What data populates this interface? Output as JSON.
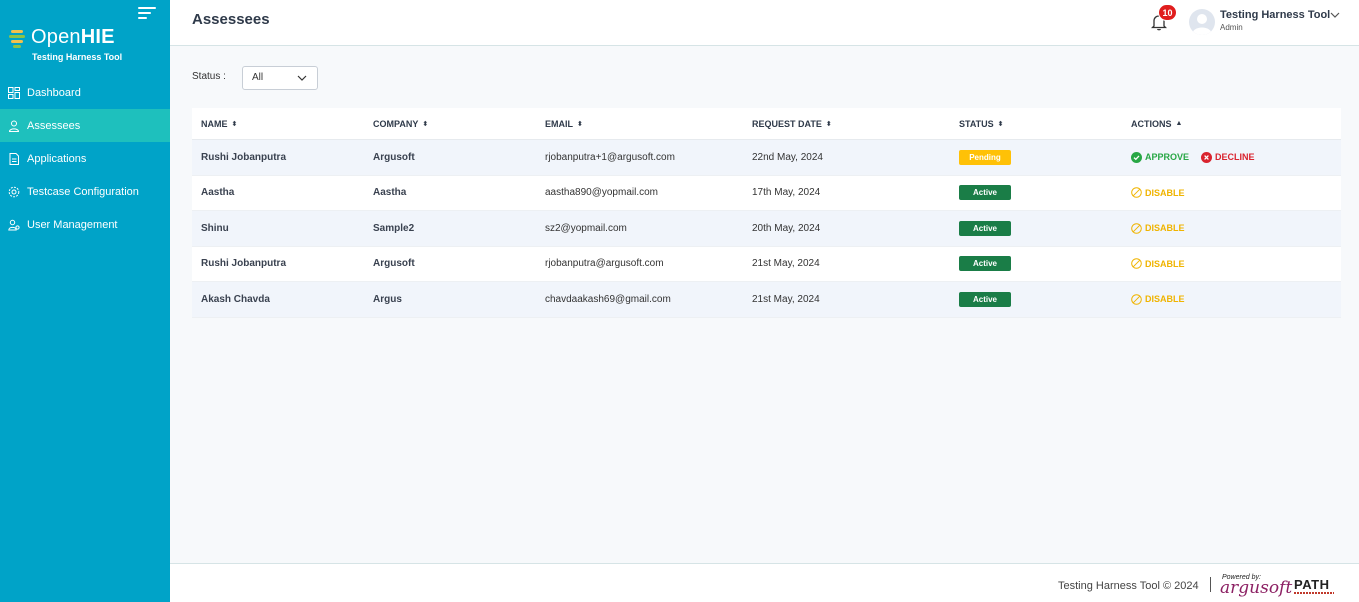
{
  "app": {
    "logo_prefix": "Open",
    "logo_bold": "HIE",
    "logo_subtitle": "Testing Harness Tool"
  },
  "sidebar": {
    "items": [
      {
        "label": "Dashboard",
        "icon": "dashboard-icon"
      },
      {
        "label": "Assessees",
        "icon": "user-icon",
        "active": true
      },
      {
        "label": "Applications",
        "icon": "document-icon"
      },
      {
        "label": "Testcase Configuration",
        "icon": "gear-icon"
      },
      {
        "label": "User Management",
        "icon": "users-icon"
      }
    ]
  },
  "header": {
    "title": "Assessees",
    "notification_count": "10",
    "user_name": "Testing Harness Tool",
    "user_role": "Admin"
  },
  "filter": {
    "label": "Status :",
    "selected": "All"
  },
  "table": {
    "columns": [
      "NAME",
      "COMPANY",
      "EMAIL",
      "REQUEST DATE",
      "STATUS",
      "ACTIONS"
    ],
    "rows": [
      {
        "name": "Rushi Jobanputra",
        "company": "Argusoft",
        "email": "rjobanputra+1@argusoft.com",
        "date": "22nd May, 2024",
        "status": "Pending",
        "actions": [
          "APPROVE",
          "DECLINE"
        ]
      },
      {
        "name": "Aastha",
        "company": "Aastha",
        "email": "aastha890@yopmail.com",
        "date": "17th May, 2024",
        "status": "Active",
        "actions": [
          "DISABLE"
        ]
      },
      {
        "name": "Shinu",
        "company": "Sample2",
        "email": "sz2@yopmail.com",
        "date": "20th May, 2024",
        "status": "Active",
        "actions": [
          "DISABLE"
        ]
      },
      {
        "name": "Rushi Jobanputra",
        "company": "Argusoft",
        "email": "rjobanputra@argusoft.com",
        "date": "21st May, 2024",
        "status": "Active",
        "actions": [
          "DISABLE"
        ]
      },
      {
        "name": "Akash Chavda",
        "company": "Argus",
        "email": "chavdaakash69@gmail.com",
        "date": "21st May, 2024",
        "status": "Active",
        "actions": [
          "DISABLE"
        ]
      }
    ]
  },
  "footer": {
    "copyright": "Testing Harness Tool © 2024",
    "powered_by": "Powered by:",
    "argusoft": "argusoft",
    "path": "PATH"
  },
  "colors": {
    "sidebar": "#00a3c8",
    "active_item": "#1ec0bd",
    "pending": "#ffc107",
    "active": "#1a7d47",
    "approve": "#28a745",
    "decline": "#d9232e",
    "disable": "#f0b400"
  }
}
